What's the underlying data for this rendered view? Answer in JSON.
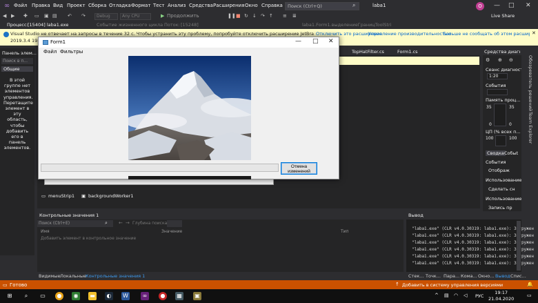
{
  "menubar": {
    "items": [
      "Файл",
      "Правка",
      "Вид",
      "Проект",
      "Сборка",
      "Отладка",
      "Формат",
      "Тест",
      "Анализ",
      "Средства",
      "Расширения",
      "Окно",
      "Справка"
    ],
    "search_placeholder": "Поиск (Ctrl+Q)",
    "app_title": "laba1",
    "avatar_letter": "O"
  },
  "toolbar": {
    "debug_combo": "Debug",
    "cpu_combo": "Any CPU",
    "continue_label": "Продолжить",
    "live_share": "Live Share"
  },
  "processbar": {
    "label": "Процесс:",
    "value": "[15404] laba1.exe",
    "events_label": "Событие жизненного цикла",
    "thread_label": "Поток:",
    "thread_value": "[15248]",
    "stack_frame": "laba1.Form1.выделениеГраницToolStri"
  },
  "infobar": {
    "text": "Visual Studio не отвечает на запросы в течение 32 с. Чтобы устранить эту проблему, попробуйте отключить расширение JetBrains ReSharper Ultimate",
    "version": "2019.3.4 193.0.2",
    "links": [
      "Отключить это расширение",
      "Больше не сообщать об этом расширении"
    ],
    "link_perf": "Управление производительностью"
  },
  "toolbox": {
    "title": "Панель элем...",
    "search": "Поиск в п...",
    "group": "Общие",
    "empty_text": "В этой\nгруппе нет\nэлементов\nуправления.\nПеретащите\nэлемент в\nэту область,\nчтобы\nдобавить\nего в\nпанель\nэлементов."
  },
  "doc_tabs": [
    "TopHatFilter.cs",
    "Form1.cs"
  ],
  "tray": [
    "menuStrip1",
    "backgroundWorker1"
  ],
  "form1": {
    "title": "Form1",
    "menu": [
      "Файл",
      "Фильтры"
    ],
    "cancel_button": "Отмена\nизменений",
    "progress_fraction": 0
  },
  "diagnostics": {
    "title": "Средства диагност...",
    "session_label": "Сеанс диагност...",
    "session_value": "1:20",
    "events_label": "События",
    "memory_label": "Память проц...",
    "memory_max_left": "35",
    "memory_max_right": "35",
    "memory_min_left": "0",
    "memory_min_right": "0",
    "cpu_label": "ЦП (% всех п...",
    "cpu_max_left": "100",
    "cpu_max_right": "100",
    "tabs": [
      "Сводка",
      "Собыt"
    ],
    "section_events": "События",
    "item_show": "Отображ",
    "usage1": "Использование п",
    "item_snapshot": "Сделать сн",
    "usage2": "Использование L",
    "item_record": "Запись пр"
  },
  "vertical_tabs": [
    "Обозреватель решений",
    "Team Explorer"
  ],
  "watch": {
    "title": "Контрольные значения 1",
    "search": "Поиск (Ctrl+E)",
    "depth_label": "Глубина поиска:",
    "columns": [
      "Имя",
      "Значение",
      "Тип"
    ],
    "add_item": "Добавить элемент в контрольное значение"
  },
  "output": {
    "title": "Вывод",
    "lines": [
      "\"laba1.exe\" (CLR v4.0.30319: laba1.exe): Загружен",
      "\"laba1.exe\" (CLR v4.0.30319: laba1.exe): Загружен",
      "\"laba1.exe\" (CLR v4.0.30319: laba1.exe): Загружен",
      "\"laba1.exe\" (CLR v4.0.30319: laba1.exe): Загружен",
      "\"laba1.exe\" (CLR v4.0.30319: laba1.exe): Загружен",
      "\"laba1.exe\" (CLR v4.0.30319: laba1.exe): Загружен"
    ]
  },
  "bottom_tabs_left": [
    "Видимые",
    "Локальные",
    "Контрольные значения 1"
  ],
  "bottom_tabs_right": [
    "Стек...",
    "Точк...",
    "Пара...",
    "Кома...",
    "Окно...",
    "Вывод",
    "Спис..."
  ],
  "statusbar": {
    "ready": "Готово",
    "vcs": "Добавить в систему управления версиями"
  },
  "taskbar": {
    "lang": "РУС",
    "time": "19:17",
    "date": "21.04.2020"
  },
  "colors": {
    "vs_dark": "#2d2d30",
    "status_orange": "#ca5100",
    "infobar_yellow": "#fefcc7",
    "accent_blue": "#0078d7"
  }
}
